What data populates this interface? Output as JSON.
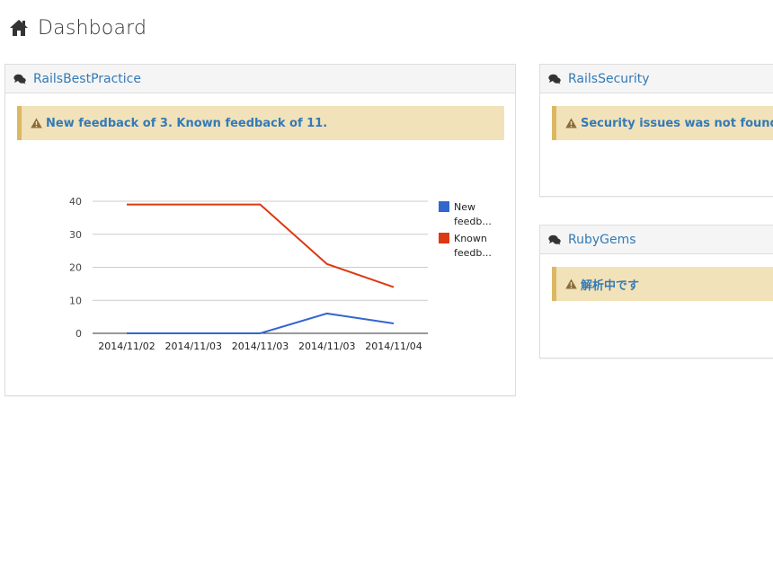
{
  "page": {
    "title": "Dashboard",
    "icon": "home-icon"
  },
  "panels": {
    "best_practice": {
      "title": "RailsBestPractice",
      "icon": "comments-icon",
      "alert": {
        "icon": "warning-icon",
        "text": "New feedback of 3. Known feedback of 11."
      }
    },
    "security": {
      "title": "RailsSecurity",
      "icon": "comments-icon",
      "alert": {
        "icon": "warning-icon",
        "text": "Security issues was not found."
      }
    },
    "rubygems": {
      "title": "RubyGems",
      "icon": "comments-icon",
      "alert": {
        "icon": "warning-icon",
        "text": "解析中です"
      }
    }
  },
  "colors": {
    "accent": "#337ab7",
    "alert_bg": "#f2e2b9",
    "alert_border": "#dbb863"
  },
  "chart_data": {
    "type": "line",
    "categories": [
      "2014/11/02",
      "2014/11/03",
      "2014/11/03",
      "2014/11/03",
      "2014/11/04"
    ],
    "series": [
      {
        "name": "New feedb...",
        "color": "#3366cc",
        "values": [
          0,
          0,
          0,
          6,
          3
        ]
      },
      {
        "name": "Known feedb...",
        "color": "#dc3912",
        "values": [
          39,
          39,
          39,
          21,
          14
        ]
      }
    ],
    "yticks": [
      0,
      10,
      20,
      30,
      40
    ],
    "ylim": [
      0,
      40
    ],
    "grid": true,
    "legend_position": "right"
  }
}
